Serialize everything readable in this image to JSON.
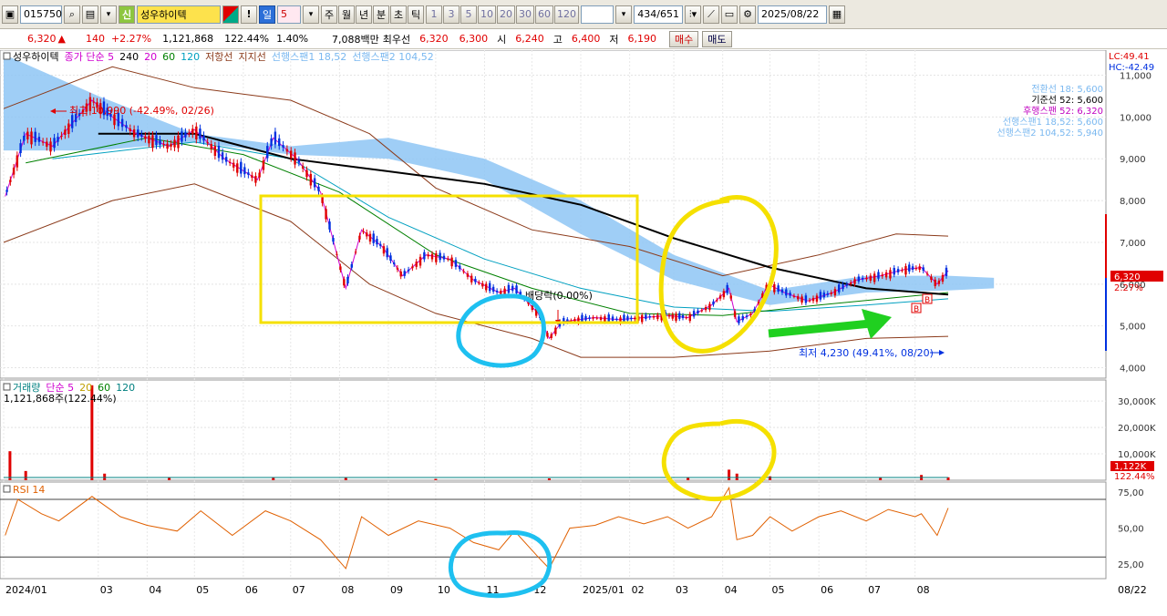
{
  "toolbar": {
    "code": "015750",
    "new_badge": "신",
    "stock_name": "성우하이텍",
    "alert_label": "!",
    "period_day": "일",
    "period_n": "5",
    "periods": [
      "주",
      "월",
      "년",
      "분",
      "초",
      "틱"
    ],
    "minutes": [
      "1",
      "3",
      "5",
      "10",
      "20",
      "30",
      "60",
      "120"
    ],
    "counter": "434/651",
    "date": "2025/08/22"
  },
  "quote": {
    "price": "6,320",
    "arrow": "▲",
    "change": "140",
    "change_pct": "+2.27%",
    "volume": "1,121,868",
    "volume_ratio": "122.44%",
    "turnover": "1.40%",
    "amount": "7,088백만",
    "best_ask_label": "최우선",
    "best_ask": "6,320",
    "best_bid": "6,300",
    "open_label": "시",
    "open": "6,240",
    "high_label": "고",
    "high": "6,400",
    "low_label": "저",
    "low": "6,190",
    "buy_label": "매수",
    "sell_label": "매도"
  },
  "price_panel": {
    "legend": [
      {
        "text": "성우하이텍",
        "color": "#000000"
      },
      {
        "text": "종가 단순 5",
        "color": "#d000d0"
      },
      {
        "text": "240",
        "color": "#000000"
      },
      {
        "text": "20",
        "color": "#d000d0"
      },
      {
        "text": "60",
        "color": "#008000"
      },
      {
        "text": "120",
        "color": "#00a0c0"
      },
      {
        "text": "저항선",
        "color": "#8b3a1a"
      },
      {
        "text": "지지선",
        "color": "#8b3a1a"
      },
      {
        "text": "선행스팬1 18,52",
        "color": "#7ab8f0"
      },
      {
        "text": "선행스팬2 104,52",
        "color": "#7ab8f0"
      }
    ],
    "lc": "LC:49.41",
    "hc": "HC:-42.49",
    "ichimoku_box": [
      {
        "text": "전환선 18: 5,600",
        "color": "#7ab8f0"
      },
      {
        "text": "기준선 52: 5,600",
        "color": "#000000"
      },
      {
        "text": "후행스팬 52: 6,320",
        "color": "#c000c0"
      },
      {
        "text": "선행스팬1 18,52: 5,600",
        "color": "#7ab8f0"
      },
      {
        "text": "선행스팬2 104,52: 5,940",
        "color": "#7ab8f0"
      }
    ],
    "high_note": "최고 10,990 (-42.49%, 02/26)",
    "low_note": "최저 4,230 (49.41%, 08/20)",
    "dividend_note": "배당락(0.00%)",
    "current_price_tag": "6,320",
    "current_pct_tag": "2.27%",
    "buy_marker": "B"
  },
  "volume_panel": {
    "legend": [
      {
        "text": "거래량",
        "color": "#008080"
      },
      {
        "text": "단순 5",
        "color": "#d000d0"
      },
      {
        "text": "20",
        "color": "#c0a000"
      },
      {
        "text": "60",
        "color": "#008000"
      },
      {
        "text": "120",
        "color": "#008080"
      }
    ],
    "value_note": "1,121,868주(122.44%)",
    "tag_value": "1,122K",
    "tag_pct": "122.44%"
  },
  "rsi_panel": {
    "legend": "RSI 14"
  },
  "x_axis_end_label": "08/22",
  "colors": {
    "up": "#e00000",
    "down": "#0030e0",
    "cloud": "#8ec5f4",
    "highlight_yellow": "#f5e000",
    "highlight_cyan": "#1ec0f0",
    "arrow_green": "#20d020"
  },
  "chart_data": [
    {
      "type": "candlestick",
      "title": "성우하이텍",
      "x_range": [
        "2024/01",
        "2025/08/22"
      ],
      "x_ticks": [
        "2024/01",
        "03",
        "04",
        "05",
        "06",
        "07",
        "08",
        "09",
        "10",
        "11",
        "12",
        "2025/01",
        "02",
        "03",
        "04",
        "05",
        "06",
        "07",
        "08"
      ],
      "y_ticks": [
        4000,
        5000,
        6000,
        7000,
        8000,
        9000,
        10000,
        11000
      ],
      "y_tick_labels": [
        "4,000",
        "5,000",
        "6,000",
        "7,000",
        "8,000",
        "9,000",
        "10,000",
        "11,000"
      ],
      "ylim": [
        3750,
        11600
      ],
      "close_series": [
        {
          "x": "2024/01/02",
          "y": 8100
        },
        {
          "x": "2024/01/15",
          "y": 9600
        },
        {
          "x": "2024/02/01",
          "y": 9300
        },
        {
          "x": "2024/02/26",
          "y": 10400
        },
        {
          "x": "2024/03/10",
          "y": 10000
        },
        {
          "x": "2024/03/25",
          "y": 9600
        },
        {
          "x": "2024/04/15",
          "y": 9300
        },
        {
          "x": "2024/05/01",
          "y": 9700
        },
        {
          "x": "2024/05/20",
          "y": 9000
        },
        {
          "x": "2024/06/10",
          "y": 8500
        },
        {
          "x": "2024/06/20",
          "y": 9500
        },
        {
          "x": "2024/07/05",
          "y": 9000
        },
        {
          "x": "2024/07/20",
          "y": 8200
        },
        {
          "x": "2024/08/05",
          "y": 5900
        },
        {
          "x": "2024/08/15",
          "y": 7300
        },
        {
          "x": "2024/08/28",
          "y": 6900
        },
        {
          "x": "2024/09/10",
          "y": 6200
        },
        {
          "x": "2024/09/25",
          "y": 6700
        },
        {
          "x": "2024/10/10",
          "y": 6600
        },
        {
          "x": "2024/10/25",
          "y": 6100
        },
        {
          "x": "2024/11/10",
          "y": 5800
        },
        {
          "x": "2024/11/20",
          "y": 5900
        },
        {
          "x": "2024/12/05",
          "y": 5300
        },
        {
          "x": "2024/12/12",
          "y": 4700
        },
        {
          "x": "2024/12/20",
          "y": 5100
        },
        {
          "x": "2025/01/10",
          "y": 5200
        },
        {
          "x": "2025/01/25",
          "y": 5150
        },
        {
          "x": "2025/02/10",
          "y": 5200
        },
        {
          "x": "2025/02/25",
          "y": 5250
        },
        {
          "x": "2025/03/10",
          "y": 5200
        },
        {
          "x": "2025/03/25",
          "y": 5500
        },
        {
          "x": "2025/04/05",
          "y": 5900
        },
        {
          "x": "2025/04/10",
          "y": 5100
        },
        {
          "x": "2025/04/20",
          "y": 5300
        },
        {
          "x": "2025/04/30",
          "y": 6000
        },
        {
          "x": "2025/05/10",
          "y": 5800
        },
        {
          "x": "2025/05/25",
          "y": 5600
        },
        {
          "x": "2025/06/10",
          "y": 5800
        },
        {
          "x": "2025/06/25",
          "y": 6100
        },
        {
          "x": "2025/07/10",
          "y": 6200
        },
        {
          "x": "2025/07/25",
          "y": 6350
        },
        {
          "x": "2025/08/05",
          "y": 6400
        },
        {
          "x": "2025/08/15",
          "y": 6000
        },
        {
          "x": "2025/08/22",
          "y": 6320
        }
      ],
      "ma240": [
        {
          "x": "2024/03/01",
          "y": 9600
        },
        {
          "x": "2024/05/01",
          "y": 9600
        },
        {
          "x": "2024/07/01",
          "y": 9000
        },
        {
          "x": "2024/09/01",
          "y": 8700
        },
        {
          "x": "2024/11/01",
          "y": 8400
        },
        {
          "x": "2025/01/01",
          "y": 7900
        },
        {
          "x": "2025/03/01",
          "y": 7100
        },
        {
          "x": "2025/05/01",
          "y": 6400
        },
        {
          "x": "2025/07/01",
          "y": 5900
        },
        {
          "x": "2025/08/22",
          "y": 5750
        }
      ],
      "ma60": [
        {
          "x": "2024/01/15",
          "y": 8900
        },
        {
          "x": "2024/04/01",
          "y": 9500
        },
        {
          "x": "2024/06/01",
          "y": 9100
        },
        {
          "x": "2024/08/01",
          "y": 8200
        },
        {
          "x": "2024/10/01",
          "y": 6700
        },
        {
          "x": "2024/12/01",
          "y": 5900
        },
        {
          "x": "2025/02/01",
          "y": 5300
        },
        {
          "x": "2025/04/01",
          "y": 5250
        },
        {
          "x": "2025/06/01",
          "y": 5500
        },
        {
          "x": "2025/08/22",
          "y": 5800
        }
      ],
      "ma120": [
        {
          "x": "2024/02/01",
          "y": 9000
        },
        {
          "x": "2024/05/01",
          "y": 9400
        },
        {
          "x": "2024/07/01",
          "y": 9000
        },
        {
          "x": "2024/09/01",
          "y": 7600
        },
        {
          "x": "2024/11/01",
          "y": 6600
        },
        {
          "x": "2025/01/01",
          "y": 5900
        },
        {
          "x": "2025/03/01",
          "y": 5450
        },
        {
          "x": "2025/05/01",
          "y": 5350
        },
        {
          "x": "2025/07/01",
          "y": 5500
        },
        {
          "x": "2025/08/22",
          "y": 5650
        }
      ],
      "resistance_band": [
        {
          "x": "2024/01/01",
          "y": 10200
        },
        {
          "x": "2024/03/10",
          "y": 11200
        },
        {
          "x": "2024/05/01",
          "y": 10700
        },
        {
          "x": "2024/07/01",
          "y": 10400
        },
        {
          "x": "2024/08/20",
          "y": 9600
        },
        {
          "x": "2024/10/01",
          "y": 8300
        },
        {
          "x": "2024/12/01",
          "y": 7300
        },
        {
          "x": "2025/02/01",
          "y": 6900
        },
        {
          "x": "2025/04/01",
          "y": 6200
        },
        {
          "x": "2025/06/01",
          "y": 6700
        },
        {
          "x": "2025/07/20",
          "y": 7200
        },
        {
          "x": "2025/08/22",
          "y": 7150
        }
      ],
      "support_band": [
        {
          "x": "2024/01/01",
          "y": 7000
        },
        {
          "x": "2024/03/10",
          "y": 8000
        },
        {
          "x": "2024/05/01",
          "y": 8400
        },
        {
          "x": "2024/07/01",
          "y": 7500
        },
        {
          "x": "2024/08/20",
          "y": 6000
        },
        {
          "x": "2024/10/01",
          "y": 5300
        },
        {
          "x": "2024/12/01",
          "y": 4700
        },
        {
          "x": "2025/01/01",
          "y": 4250
        },
        {
          "x": "2025/03/01",
          "y": 4250
        },
        {
          "x": "2025/05/01",
          "y": 4400
        },
        {
          "x": "2025/07/01",
          "y": 4700
        },
        {
          "x": "2025/08/22",
          "y": 4750
        }
      ],
      "cloud": [
        {
          "x": "2024/01/01",
          "a": 11500,
          "b": 9200
        },
        {
          "x": "2024/03/01",
          "a": 10500,
          "b": 9200
        },
        {
          "x": "2024/05/01",
          "a": 9600,
          "b": 9400
        },
        {
          "x": "2024/07/01",
          "a": 9300,
          "b": 9100
        },
        {
          "x": "2024/09/01",
          "a": 9500,
          "b": 9000
        },
        {
          "x": "2024/11/01",
          "a": 9000,
          "b": 8500
        },
        {
          "x": "2025/01/01",
          "a": 8000,
          "b": 7200
        },
        {
          "x": "2025/03/01",
          "a": 6700,
          "b": 6100
        },
        {
          "x": "2025/05/01",
          "a": 5850,
          "b": 5500
        },
        {
          "x": "2025/07/01",
          "a": 6200,
          "b": 5800
        },
        {
          "x": "2025/08/22",
          "a": 6200,
          "b": 5850
        },
        {
          "x": "2025/09/20",
          "a": 6150,
          "b": 5900
        }
      ]
    },
    {
      "type": "bar",
      "title": "거래량",
      "y_ticks": [
        10000,
        20000,
        30000
      ],
      "y_tick_labels": [
        "10,000K",
        "20,000K",
        "30,000K"
      ],
      "ylim": [
        0,
        38000
      ],
      "points": [
        {
          "x": "2024/01/05",
          "y": 11000
        },
        {
          "x": "2024/01/15",
          "y": 3500
        },
        {
          "x": "2024/02/26",
          "y": 36000
        },
        {
          "x": "2024/03/05",
          "y": 2500
        },
        {
          "x": "2024/04/15",
          "y": 900
        },
        {
          "x": "2024/06/20",
          "y": 1000
        },
        {
          "x": "2024/08/05",
          "y": 900
        },
        {
          "x": "2024/10/01",
          "y": 500
        },
        {
          "x": "2024/12/12",
          "y": 700
        },
        {
          "x": "2025/03/10",
          "y": 1200
        },
        {
          "x": "2025/04/05",
          "y": 4000
        },
        {
          "x": "2025/04/10",
          "y": 2500
        },
        {
          "x": "2025/05/01",
          "y": 1500
        },
        {
          "x": "2025/07/10",
          "y": 900
        },
        {
          "x": "2025/08/05",
          "y": 2000
        },
        {
          "x": "2025/08/22",
          "y": 1122
        }
      ]
    },
    {
      "type": "line",
      "title": "RSI 14",
      "y_ticks": [
        25,
        50,
        75
      ],
      "y_tick_labels": [
        "25,00",
        "50,00",
        "75,00"
      ],
      "ylim": [
        15,
        82
      ],
      "reference_lines": [
        70,
        30
      ],
      "points": [
        {
          "x": "2024/01/02",
          "y": 45
        },
        {
          "x": "2024/01/10",
          "y": 70
        },
        {
          "x": "2024/01/25",
          "y": 60
        },
        {
          "x": "2024/02/05",
          "y": 55
        },
        {
          "x": "2024/02/26",
          "y": 72
        },
        {
          "x": "2024/03/15",
          "y": 58
        },
        {
          "x": "2024/04/01",
          "y": 52
        },
        {
          "x": "2024/04/20",
          "y": 48
        },
        {
          "x": "2024/05/05",
          "y": 62
        },
        {
          "x": "2024/05/25",
          "y": 45
        },
        {
          "x": "2024/06/15",
          "y": 62
        },
        {
          "x": "2024/07/01",
          "y": 55
        },
        {
          "x": "2024/07/20",
          "y": 42
        },
        {
          "x": "2024/08/05",
          "y": 22
        },
        {
          "x": "2024/08/15",
          "y": 58
        },
        {
          "x": "2024/09/01",
          "y": 45
        },
        {
          "x": "2024/09/20",
          "y": 55
        },
        {
          "x": "2024/10/10",
          "y": 50
        },
        {
          "x": "2024/10/25",
          "y": 40
        },
        {
          "x": "2024/11/10",
          "y": 35
        },
        {
          "x": "2024/11/20",
          "y": 48
        },
        {
          "x": "2024/12/05",
          "y": 30
        },
        {
          "x": "2024/12/12",
          "y": 22
        },
        {
          "x": "2024/12/25",
          "y": 50
        },
        {
          "x": "2025/01/10",
          "y": 52
        },
        {
          "x": "2025/01/25",
          "y": 58
        },
        {
          "x": "2025/02/10",
          "y": 53
        },
        {
          "x": "2025/02/25",
          "y": 58
        },
        {
          "x": "2025/03/10",
          "y": 50
        },
        {
          "x": "2025/03/25",
          "y": 58
        },
        {
          "x": "2025/04/05",
          "y": 78
        },
        {
          "x": "2025/04/10",
          "y": 42
        },
        {
          "x": "2025/04/20",
          "y": 45
        },
        {
          "x": "2025/05/01",
          "y": 58
        },
        {
          "x": "2025/05/15",
          "y": 48
        },
        {
          "x": "2025/06/01",
          "y": 58
        },
        {
          "x": "2025/06/15",
          "y": 62
        },
        {
          "x": "2025/07/01",
          "y": 55
        },
        {
          "x": "2025/07/15",
          "y": 63
        },
        {
          "x": "2025/08/01",
          "y": 58
        },
        {
          "x": "2025/08/05",
          "y": 60
        },
        {
          "x": "2025/08/15",
          "y": 45
        },
        {
          "x": "2025/08/22",
          "y": 64
        }
      ]
    }
  ]
}
